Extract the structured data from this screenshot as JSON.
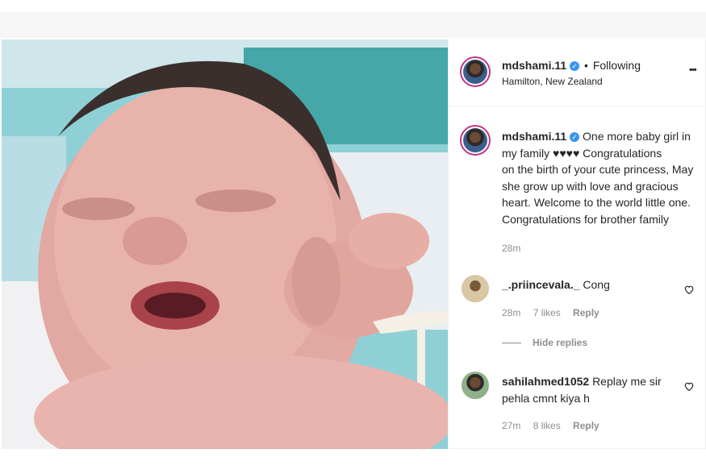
{
  "header": {
    "username": "mdshami.11",
    "separator": "•",
    "follow_status": "Following",
    "location": "Hamilton, New Zealand",
    "more_label": "•••"
  },
  "caption": {
    "username": "mdshami.11",
    "lines": [
      "One more baby girl in",
      "my family ♥♥♥♥ Congratulations",
      "on the birth of your cute princess, May",
      "she grow up with love and gracious",
      "heart. Welcome to the world little one.",
      "Congratulations for brother family"
    ],
    "time": "28m"
  },
  "comments": [
    {
      "username": "_.priincevala._",
      "text": "Cong",
      "time": "28m",
      "likes": "7 likes",
      "reply_label": "Reply",
      "hide_replies_label": "Hide replies"
    },
    {
      "username": "sahilahmed1052",
      "text_line1": "Replay me sir",
      "text_line2": "pehla cmnt kiya h",
      "time": "27m",
      "likes": "8 likes",
      "reply_label": "Reply"
    }
  ],
  "colors": {
    "verified": "#3897f0",
    "story_ring": "#c13584",
    "text": "#262626",
    "muted": "#8e8e8e"
  }
}
